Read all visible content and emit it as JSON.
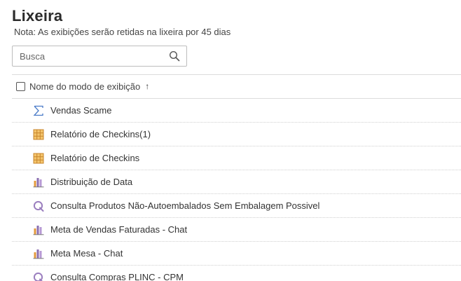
{
  "page": {
    "title": "Lixeira",
    "note": "Nota: As exibições serão retidas na lixeira por 45 dias"
  },
  "search": {
    "placeholder": "Busca",
    "value": "",
    "icon": "search-icon"
  },
  "table": {
    "header": {
      "label": "Nome do modo de exibição",
      "sort_indicator": "↑"
    },
    "rows": [
      {
        "label": "Vendas Scame",
        "icon": "sum-icon"
      },
      {
        "label": "Relatório de Checkins(1)",
        "icon": "table-icon"
      },
      {
        "label": "Relatório de Checkins",
        "icon": "table-icon"
      },
      {
        "label": "Distribuição de Data",
        "icon": "bar-chart-icon"
      },
      {
        "label": "Consulta Produtos Não-Autoembalados Sem Embalagem Possivel",
        "icon": "query-icon"
      },
      {
        "label": "Meta de Vendas Faturadas - Chat",
        "icon": "bar-chart-icon"
      },
      {
        "label": "Meta Mesa - Chat",
        "icon": "bar-chart-icon"
      },
      {
        "label": "Consulta Compras PLINC - CPM",
        "icon": "query-icon"
      }
    ]
  },
  "colors": {
    "table_icon": "#e0a84a",
    "bar_chart_purple": "#8b6fb0",
    "bar_chart_orange": "#e39a3c",
    "query_icon": "#9b7fbf",
    "sum_icon": "#4a7bc8"
  }
}
